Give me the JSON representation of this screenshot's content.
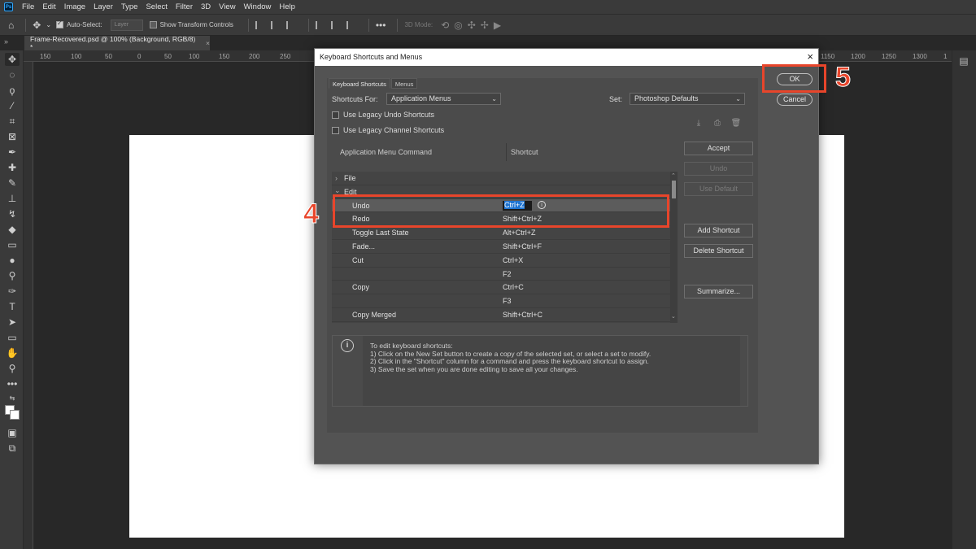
{
  "menubar": {
    "logo": "Ps",
    "items": [
      "File",
      "Edit",
      "Image",
      "Layer",
      "Type",
      "Select",
      "Filter",
      "3D",
      "View",
      "Window",
      "Help"
    ]
  },
  "options_bar": {
    "auto_select_label": "Auto-Select:",
    "auto_select_value": "Layer",
    "show_transform_label": "Show Transform Controls",
    "mode_3d_label": "3D Mode:"
  },
  "document_tab": {
    "title": "Frame-Recovered.psd @ 100% (Background, RGB/8) *",
    "close": "×"
  },
  "ruler": {
    "labels": [
      "150",
      "100",
      "50",
      "0",
      "50",
      "100",
      "150",
      "200",
      "250",
      "1150",
      "1200",
      "1250",
      "1300",
      "1"
    ]
  },
  "dialog": {
    "title": "Keyboard Shortcuts and Menus",
    "close": "×",
    "tabs": [
      "Keyboard Shortcuts",
      "Menus"
    ],
    "shortcuts_for_label": "Shortcuts For:",
    "shortcuts_for_value": "Application Menus",
    "set_label": "Set:",
    "set_value": "Photoshop Defaults",
    "legacy_undo": "Use Legacy Undo Shortcuts",
    "legacy_channel": "Use Legacy Channel Shortcuts",
    "col_command": "Application Menu Command",
    "col_shortcut": "Shortcut",
    "rows": [
      {
        "cmd": "File",
        "sc": "",
        "group": true,
        "arrow": "›"
      },
      {
        "cmd": "Edit",
        "sc": "",
        "group": true,
        "arrow": "⌄"
      },
      {
        "cmd": "Undo",
        "sc": "Ctrl+Z",
        "selected": true
      },
      {
        "cmd": "Redo",
        "sc": "Shift+Ctrl+Z"
      },
      {
        "cmd": "Toggle Last State",
        "sc": "Alt+Ctrl+Z"
      },
      {
        "cmd": "Fade...",
        "sc": "Shift+Ctrl+F"
      },
      {
        "cmd": "Cut",
        "sc": "Ctrl+X"
      },
      {
        "cmd": "",
        "sc": "F2"
      },
      {
        "cmd": "Copy",
        "sc": "Ctrl+C"
      },
      {
        "cmd": "",
        "sc": "F3"
      },
      {
        "cmd": "Copy Merged",
        "sc": "Shift+Ctrl+C"
      }
    ],
    "buttons": {
      "accept": "Accept",
      "undo": "Undo",
      "use_default": "Use Default",
      "add_shortcut": "Add Shortcut",
      "delete_shortcut": "Delete Shortcut",
      "summarize": "Summarize...",
      "ok": "OK",
      "cancel": "Cancel"
    },
    "info_lines": [
      "To edit keyboard shortcuts:",
      "1) Click on the New Set button to create a copy of the selected set, or select a set to modify.",
      "2) Click in the \"Shortcut\" column for a command and press the keyboard shortcut to assign.",
      "3) Save the set when you are done editing to save all your changes."
    ]
  },
  "annotations": {
    "step4": "4",
    "step5": "5",
    "color": "#e8452b"
  }
}
